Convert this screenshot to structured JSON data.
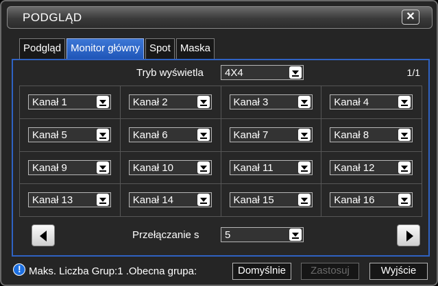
{
  "window": {
    "title": "PODGLĄD",
    "close_label": "✕"
  },
  "tabs": [
    {
      "label": "Podgląd",
      "active": false
    },
    {
      "label": "Monitor główny",
      "active": true
    },
    {
      "label": "Spot",
      "active": false
    },
    {
      "label": "Maska",
      "active": false
    }
  ],
  "display_mode": {
    "label": "Tryb wyświetla",
    "value": "4X4"
  },
  "page_indicator": "1/1",
  "channels": [
    "Kanał 1",
    "Kanał 2",
    "Kanał 3",
    "Kanał 4",
    "Kanał 5",
    "Kanał 6",
    "Kanał 7",
    "Kanał 8",
    "Kanał 9",
    "Kanał 10",
    "Kanał 11",
    "Kanał 12",
    "Kanał 13",
    "Kanał 14",
    "Kanał 15",
    "Kanał 16"
  ],
  "switching": {
    "label": "Przełączanie s",
    "value": "5"
  },
  "footer": {
    "status": "Maks. Liczba Grup:1 .Obecna grupa:",
    "default_label": "Domyślnie",
    "apply_label": "Zastosuj",
    "exit_label": "Wyjście"
  },
  "colors": {
    "accent": "#2f63c4",
    "active_tab": "#2a63c8",
    "info": "#1d6fe0"
  }
}
